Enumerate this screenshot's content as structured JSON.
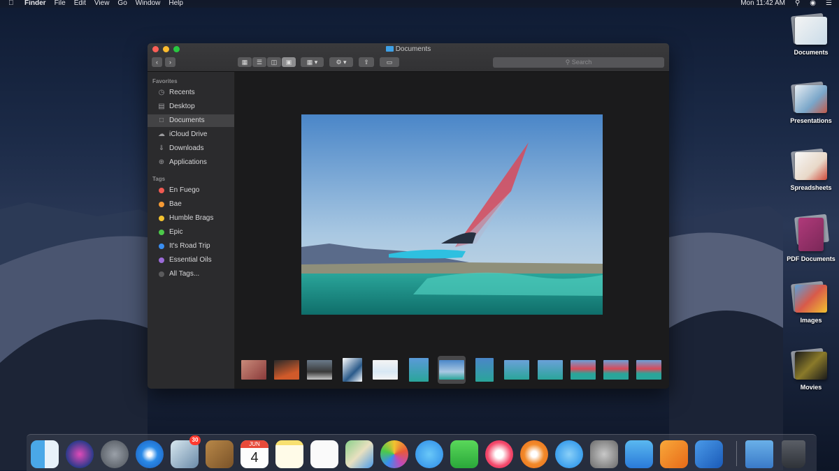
{
  "menubar": {
    "app_name": "Finder",
    "menus": [
      "File",
      "Edit",
      "View",
      "Go",
      "Window",
      "Help"
    ],
    "clock": "Mon 11:42 AM"
  },
  "window": {
    "title": "Documents",
    "search_placeholder": "Search"
  },
  "sidebar": {
    "favorites_header": "Favorites",
    "favorites": [
      {
        "label": "Recents",
        "icon": "clock-icon"
      },
      {
        "label": "Desktop",
        "icon": "desktop-icon"
      },
      {
        "label": "Documents",
        "icon": "document-icon"
      },
      {
        "label": "iCloud Drive",
        "icon": "cloud-icon"
      },
      {
        "label": "Downloads",
        "icon": "download-icon"
      },
      {
        "label": "Applications",
        "icon": "applications-icon"
      }
    ],
    "tags_header": "Tags",
    "tags": [
      {
        "label": "En Fuego",
        "color": "#ef5a52"
      },
      {
        "label": "Bae",
        "color": "#f59a35"
      },
      {
        "label": "Humble Brags",
        "color": "#f2c230"
      },
      {
        "label": "Epic",
        "color": "#4cc94a"
      },
      {
        "label": "It's Road Trip",
        "color": "#3a8ef0"
      },
      {
        "label": "Essential Oils",
        "color": "#9b6bd8"
      },
      {
        "label": "All Tags...",
        "color": "#5a5a5c"
      }
    ]
  },
  "desktop": {
    "stacks": [
      {
        "label": "Documents"
      },
      {
        "label": "Presentations"
      },
      {
        "label": "Spreadsheets"
      },
      {
        "label": "PDF Documents"
      },
      {
        "label": "Images"
      },
      {
        "label": "Movies"
      }
    ]
  },
  "dock": {
    "mail_badge": "30",
    "calendar_month": "JUN",
    "calendar_day": "4"
  }
}
